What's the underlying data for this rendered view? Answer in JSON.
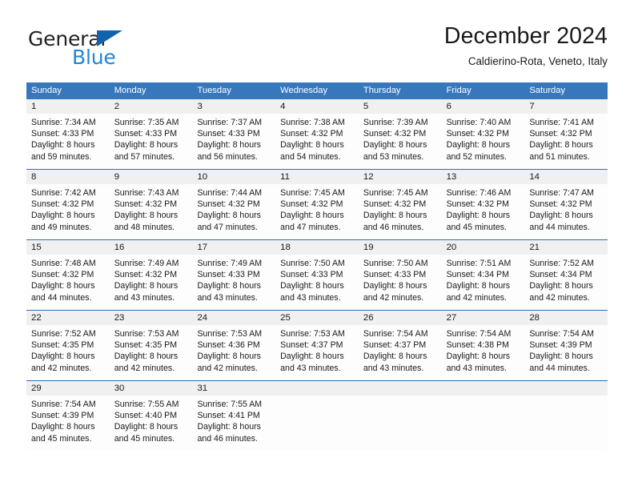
{
  "brand": {
    "name_part1": "General",
    "name_part2": "Blue",
    "triangle_icon": "triangle-icon",
    "color_dark": "#231f20",
    "color_blue": "#1e87d6"
  },
  "header": {
    "title": "December 2024",
    "subtitle": "Caldierino-Rota, Veneto, Italy"
  },
  "theme": {
    "header_bg": "#3778bc",
    "daynum_bg": "#f0f0f0",
    "rule_color": "#2f6fb0"
  },
  "weekdays": [
    "Sunday",
    "Monday",
    "Tuesday",
    "Wednesday",
    "Thursday",
    "Friday",
    "Saturday"
  ],
  "weeks": [
    {
      "days": [
        {
          "num": "1",
          "sunrise": "Sunrise: 7:34 AM",
          "sunset": "Sunset: 4:33 PM",
          "daylight1": "Daylight: 8 hours",
          "daylight2": "and 59 minutes."
        },
        {
          "num": "2",
          "sunrise": "Sunrise: 7:35 AM",
          "sunset": "Sunset: 4:33 PM",
          "daylight1": "Daylight: 8 hours",
          "daylight2": "and 57 minutes."
        },
        {
          "num": "3",
          "sunrise": "Sunrise: 7:37 AM",
          "sunset": "Sunset: 4:33 PM",
          "daylight1": "Daylight: 8 hours",
          "daylight2": "and 56 minutes."
        },
        {
          "num": "4",
          "sunrise": "Sunrise: 7:38 AM",
          "sunset": "Sunset: 4:32 PM",
          "daylight1": "Daylight: 8 hours",
          "daylight2": "and 54 minutes."
        },
        {
          "num": "5",
          "sunrise": "Sunrise: 7:39 AM",
          "sunset": "Sunset: 4:32 PM",
          "daylight1": "Daylight: 8 hours",
          "daylight2": "and 53 minutes."
        },
        {
          "num": "6",
          "sunrise": "Sunrise: 7:40 AM",
          "sunset": "Sunset: 4:32 PM",
          "daylight1": "Daylight: 8 hours",
          "daylight2": "and 52 minutes."
        },
        {
          "num": "7",
          "sunrise": "Sunrise: 7:41 AM",
          "sunset": "Sunset: 4:32 PM",
          "daylight1": "Daylight: 8 hours",
          "daylight2": "and 51 minutes."
        }
      ]
    },
    {
      "days": [
        {
          "num": "8",
          "sunrise": "Sunrise: 7:42 AM",
          "sunset": "Sunset: 4:32 PM",
          "daylight1": "Daylight: 8 hours",
          "daylight2": "and 49 minutes."
        },
        {
          "num": "9",
          "sunrise": "Sunrise: 7:43 AM",
          "sunset": "Sunset: 4:32 PM",
          "daylight1": "Daylight: 8 hours",
          "daylight2": "and 48 minutes."
        },
        {
          "num": "10",
          "sunrise": "Sunrise: 7:44 AM",
          "sunset": "Sunset: 4:32 PM",
          "daylight1": "Daylight: 8 hours",
          "daylight2": "and 47 minutes."
        },
        {
          "num": "11",
          "sunrise": "Sunrise: 7:45 AM",
          "sunset": "Sunset: 4:32 PM",
          "daylight1": "Daylight: 8 hours",
          "daylight2": "and 47 minutes."
        },
        {
          "num": "12",
          "sunrise": "Sunrise: 7:45 AM",
          "sunset": "Sunset: 4:32 PM",
          "daylight1": "Daylight: 8 hours",
          "daylight2": "and 46 minutes."
        },
        {
          "num": "13",
          "sunrise": "Sunrise: 7:46 AM",
          "sunset": "Sunset: 4:32 PM",
          "daylight1": "Daylight: 8 hours",
          "daylight2": "and 45 minutes."
        },
        {
          "num": "14",
          "sunrise": "Sunrise: 7:47 AM",
          "sunset": "Sunset: 4:32 PM",
          "daylight1": "Daylight: 8 hours",
          "daylight2": "and 44 minutes."
        }
      ]
    },
    {
      "days": [
        {
          "num": "15",
          "sunrise": "Sunrise: 7:48 AM",
          "sunset": "Sunset: 4:32 PM",
          "daylight1": "Daylight: 8 hours",
          "daylight2": "and 44 minutes."
        },
        {
          "num": "16",
          "sunrise": "Sunrise: 7:49 AM",
          "sunset": "Sunset: 4:32 PM",
          "daylight1": "Daylight: 8 hours",
          "daylight2": "and 43 minutes."
        },
        {
          "num": "17",
          "sunrise": "Sunrise: 7:49 AM",
          "sunset": "Sunset: 4:33 PM",
          "daylight1": "Daylight: 8 hours",
          "daylight2": "and 43 minutes."
        },
        {
          "num": "18",
          "sunrise": "Sunrise: 7:50 AM",
          "sunset": "Sunset: 4:33 PM",
          "daylight1": "Daylight: 8 hours",
          "daylight2": "and 43 minutes."
        },
        {
          "num": "19",
          "sunrise": "Sunrise: 7:50 AM",
          "sunset": "Sunset: 4:33 PM",
          "daylight1": "Daylight: 8 hours",
          "daylight2": "and 42 minutes."
        },
        {
          "num": "20",
          "sunrise": "Sunrise: 7:51 AM",
          "sunset": "Sunset: 4:34 PM",
          "daylight1": "Daylight: 8 hours",
          "daylight2": "and 42 minutes."
        },
        {
          "num": "21",
          "sunrise": "Sunrise: 7:52 AM",
          "sunset": "Sunset: 4:34 PM",
          "daylight1": "Daylight: 8 hours",
          "daylight2": "and 42 minutes."
        }
      ]
    },
    {
      "days": [
        {
          "num": "22",
          "sunrise": "Sunrise: 7:52 AM",
          "sunset": "Sunset: 4:35 PM",
          "daylight1": "Daylight: 8 hours",
          "daylight2": "and 42 minutes."
        },
        {
          "num": "23",
          "sunrise": "Sunrise: 7:53 AM",
          "sunset": "Sunset: 4:35 PM",
          "daylight1": "Daylight: 8 hours",
          "daylight2": "and 42 minutes."
        },
        {
          "num": "24",
          "sunrise": "Sunrise: 7:53 AM",
          "sunset": "Sunset: 4:36 PM",
          "daylight1": "Daylight: 8 hours",
          "daylight2": "and 42 minutes."
        },
        {
          "num": "25",
          "sunrise": "Sunrise: 7:53 AM",
          "sunset": "Sunset: 4:37 PM",
          "daylight1": "Daylight: 8 hours",
          "daylight2": "and 43 minutes."
        },
        {
          "num": "26",
          "sunrise": "Sunrise: 7:54 AM",
          "sunset": "Sunset: 4:37 PM",
          "daylight1": "Daylight: 8 hours",
          "daylight2": "and 43 minutes."
        },
        {
          "num": "27",
          "sunrise": "Sunrise: 7:54 AM",
          "sunset": "Sunset: 4:38 PM",
          "daylight1": "Daylight: 8 hours",
          "daylight2": "and 43 minutes."
        },
        {
          "num": "28",
          "sunrise": "Sunrise: 7:54 AM",
          "sunset": "Sunset: 4:39 PM",
          "daylight1": "Daylight: 8 hours",
          "daylight2": "and 44 minutes."
        }
      ]
    },
    {
      "days": [
        {
          "num": "29",
          "sunrise": "Sunrise: 7:54 AM",
          "sunset": "Sunset: 4:39 PM",
          "daylight1": "Daylight: 8 hours",
          "daylight2": "and 45 minutes."
        },
        {
          "num": "30",
          "sunrise": "Sunrise: 7:55 AM",
          "sunset": "Sunset: 4:40 PM",
          "daylight1": "Daylight: 8 hours",
          "daylight2": "and 45 minutes."
        },
        {
          "num": "31",
          "sunrise": "Sunrise: 7:55 AM",
          "sunset": "Sunset: 4:41 PM",
          "daylight1": "Daylight: 8 hours",
          "daylight2": "and 46 minutes."
        },
        {
          "num": "",
          "sunrise": "",
          "sunset": "",
          "daylight1": "",
          "daylight2": ""
        },
        {
          "num": "",
          "sunrise": "",
          "sunset": "",
          "daylight1": "",
          "daylight2": ""
        },
        {
          "num": "",
          "sunrise": "",
          "sunset": "",
          "daylight1": "",
          "daylight2": ""
        },
        {
          "num": "",
          "sunrise": "",
          "sunset": "",
          "daylight1": "",
          "daylight2": ""
        }
      ]
    }
  ]
}
